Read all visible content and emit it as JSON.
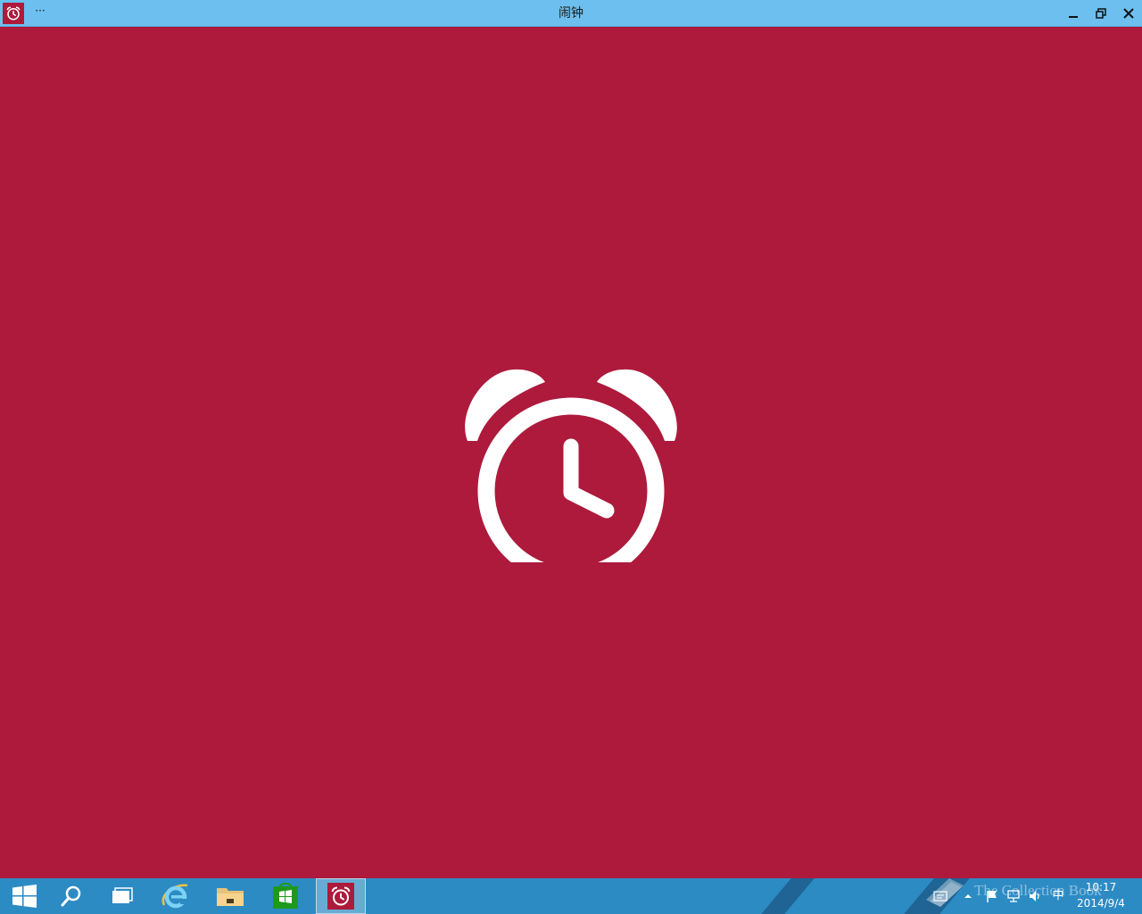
{
  "window": {
    "title": "闹钟",
    "menu_glyph": "···",
    "app_icon": "alarm-clock-icon",
    "controls": [
      "minimize-icon",
      "restore-icon",
      "close-icon"
    ]
  },
  "main": {
    "hero_icon": "alarm-clock-icon",
    "background_color": "#ad1a3c",
    "icon_color": "#ffffff"
  },
  "taskbar": {
    "background_color": "#2d8bc4",
    "buttons": [
      {
        "name": "start",
        "icon": "windows-logo-icon"
      },
      {
        "name": "search",
        "icon": "search-icon"
      },
      {
        "name": "task-view",
        "icon": "task-view-icon"
      },
      {
        "name": "internet-explorer",
        "icon": "internet-explorer-icon"
      },
      {
        "name": "file-explorer",
        "icon": "folder-icon"
      },
      {
        "name": "store",
        "icon": "store-icon"
      },
      {
        "name": "alarms",
        "icon": "alarm-clock-icon",
        "active": true
      }
    ],
    "tray": {
      "icons": [
        "show-hidden-icons-icon",
        "action-center-flag-icon",
        "network-icon",
        "volume-icon"
      ],
      "ime": "中",
      "time": "10:17",
      "date": "2014/9/4",
      "watermark": "The Collection Book"
    }
  }
}
